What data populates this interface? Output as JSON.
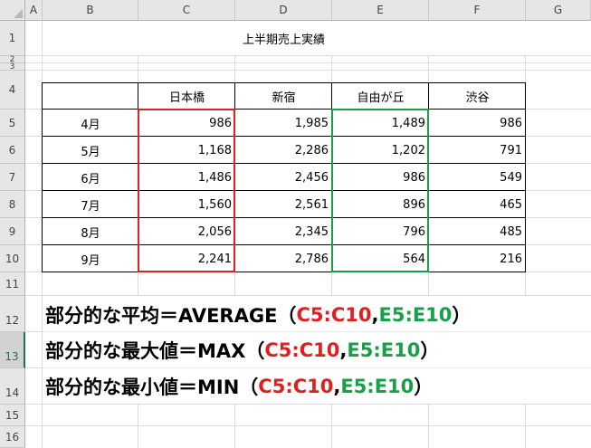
{
  "columns": [
    "A",
    "B",
    "C",
    "D",
    "E",
    "F",
    "G"
  ],
  "rows": [
    "1",
    "2",
    "3",
    "4",
    "5",
    "6",
    "7",
    "8",
    "9",
    "10",
    "11",
    "12",
    "13",
    "14",
    "15",
    "16"
  ],
  "title": "上半期売上実績",
  "table": {
    "headers": [
      "",
      "日本橋",
      "新宿",
      "自由が丘",
      "渋谷"
    ],
    "rows": [
      {
        "month": "4月",
        "values": [
          "986",
          "1,985",
          "1,489",
          "986"
        ]
      },
      {
        "month": "5月",
        "values": [
          "1,168",
          "2,286",
          "1,202",
          "791"
        ]
      },
      {
        "month": "6月",
        "values": [
          "1,486",
          "2,456",
          "986",
          "549"
        ]
      },
      {
        "month": "7月",
        "values": [
          "1,560",
          "2,561",
          "896",
          "465"
        ]
      },
      {
        "month": "8月",
        "values": [
          "2,056",
          "2,345",
          "796",
          "485"
        ]
      },
      {
        "month": "9月",
        "values": [
          "2,241",
          "2,786",
          "564",
          "216"
        ]
      }
    ]
  },
  "formulas": [
    {
      "label": "部分的な平均＝AVERAGE（",
      "range1": "C5:C10",
      "sep": ",",
      "range2": "E5:E10",
      "close": "）"
    },
    {
      "label": "部分的な最大値＝MAX（",
      "range1": "C5:C10",
      "sep": ",",
      "range2": "E5:E10",
      "close": "）"
    },
    {
      "label": "部分的な最小値＝MIN（",
      "range1": "C5:C10",
      "sep": ",",
      "range2": "E5:E10",
      "close": "）"
    }
  ],
  "colors": {
    "highlight_c": "#e02020",
    "highlight_e": "#18a048",
    "selected_row_header": "#217346"
  },
  "selected_row": "13"
}
